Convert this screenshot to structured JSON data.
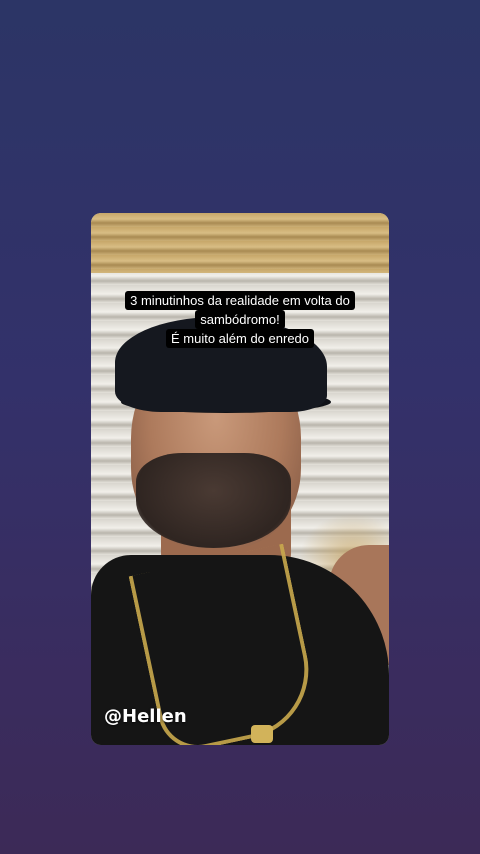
{
  "story": {
    "caption_lines": [
      "3 minutinhos da realidade em volta do",
      "sambódromo!",
      "É muito além do enredo"
    ],
    "mention": "@Hellen"
  },
  "colors": {
    "background_top": "#2c3566",
    "background_bottom": "#3c2a57",
    "caption_bg": "#000000",
    "caption_text": "#ffffff"
  }
}
